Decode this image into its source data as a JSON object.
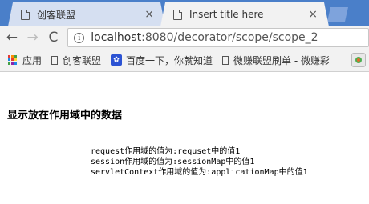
{
  "tabs": [
    {
      "title": "创客联盟",
      "close": "×",
      "active": false
    },
    {
      "title": "Insert title here",
      "close": "×",
      "active": true
    }
  ],
  "toolbar": {
    "back": "←",
    "forward": "→",
    "reload": "C",
    "info": "i",
    "url_host": "localhost",
    "url_rest": ":8080/decorator/scope/scope_2"
  },
  "bookmarks": {
    "apps_label": "应用",
    "apps_colors": [
      "#e53935",
      "#fb8c00",
      "#43a047",
      "#1e88e5",
      "#e53935",
      "#fdd835",
      "#43a047",
      "#8e24aa",
      "#1e88e5"
    ],
    "items": [
      {
        "label": "创客联盟",
        "icon": "page-icon"
      },
      {
        "label": "百度一下，你就知道",
        "icon": "baidu-paw-icon"
      },
      {
        "label": "微赚联盟刷单 - 微赚彩",
        "icon": "page-icon"
      }
    ]
  },
  "content": {
    "heading": "显示放在作用域中的数据",
    "lines": [
      "request作用域的值为:requset中的值1",
      "session作用域的值为:sessionMap中的值1",
      "servletContext作用域的值为:applicationMap中的值1"
    ]
  }
}
